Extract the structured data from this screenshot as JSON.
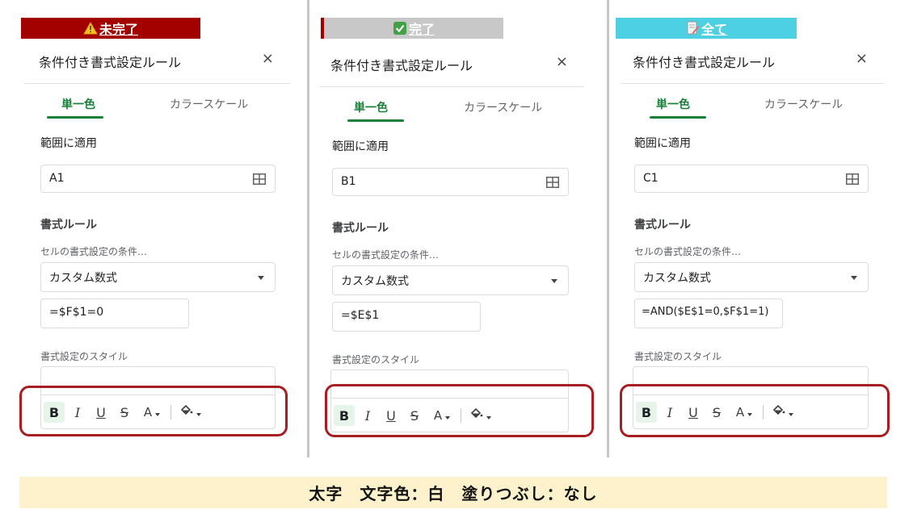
{
  "caption": "太字　文字色：白　塗りつぶし：なし",
  "panels": [
    {
      "preview_label": "未完了",
      "preview_icon": "warning-icon",
      "title": "条件付き書式設定ルール",
      "close_label": "×",
      "tab_single": "単一色",
      "tab_color_scale": "カラースケール",
      "range_label": "範囲に適用",
      "range_value": "A1",
      "rules_heading": "書式ルール",
      "condition_label": "セルの書式設定の条件…",
      "condition_value": "カスタム数式",
      "formula": "=$F$1=0",
      "style_label": "書式設定のスタイル"
    },
    {
      "preview_label": "完了",
      "preview_icon": "checkbox-icon",
      "title": "条件付き書式設定ルール",
      "close_label": "×",
      "tab_single": "単一色",
      "tab_color_scale": "カラースケール",
      "range_label": "範囲に適用",
      "range_value": "B1",
      "rules_heading": "書式ルール",
      "condition_label": "セルの書式設定の条件…",
      "condition_value": "カスタム数式",
      "formula": "=$E$1",
      "style_label": "書式設定のスタイル"
    },
    {
      "preview_label": "全て",
      "preview_icon": "memo-icon",
      "title": "条件付き書式設定ルール",
      "close_label": "×",
      "tab_single": "単一色",
      "tab_color_scale": "カラースケール",
      "range_label": "範囲に適用",
      "range_value": "C1",
      "rules_heading": "書式ルール",
      "condition_label": "セルの書式設定の条件…",
      "condition_value": "カスタム数式",
      "formula": "=AND($E$1=0,$F$1=1)",
      "style_label": "書式設定のスタイル"
    }
  ],
  "toolbar": {
    "bold": "B",
    "italic": "I",
    "underline": "U",
    "strike": "S",
    "text_color": "A"
  },
  "colors": {
    "accent_green": "#188038",
    "highlight_red": "#a71d22",
    "incomplete_bg": "#a30000",
    "complete_bg": "#c8c8c8",
    "all_bg": "#4dd0e1",
    "caption_bg": "#fdf2cc"
  }
}
